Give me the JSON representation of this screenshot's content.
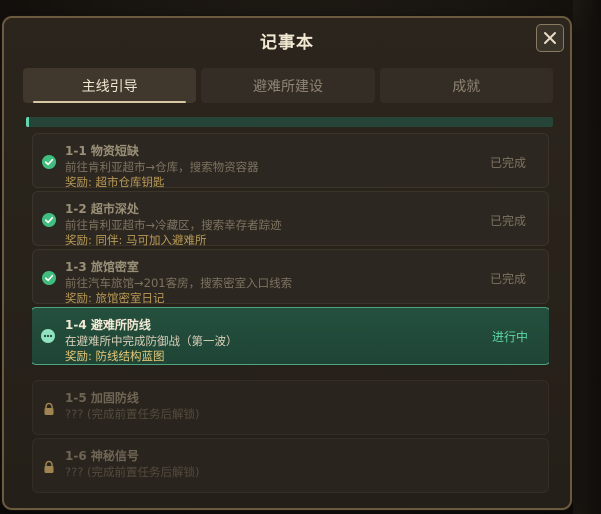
{
  "modal": {
    "title": "记事本",
    "close_icon": "close-icon"
  },
  "tabs": [
    {
      "label": "主线引导",
      "active": true
    },
    {
      "label": "避难所建设",
      "active": false
    },
    {
      "label": "成就",
      "active": false
    }
  ],
  "progress": {
    "fraction": 0.006
  },
  "quests": [
    {
      "title": "1-1 物资短缺",
      "desc": "前往肯利亚超市→仓库，搜索物资容器",
      "reward": "奖励: 超市仓库钥匙",
      "status": "已完成",
      "state": "done",
      "icon": "check-icon"
    },
    {
      "title": "1-2 超市深处",
      "desc": "前往肯利亚超市→冷藏区，搜索幸存者踪迹",
      "reward": "奖励: 同伴: 马可加入避难所",
      "status": "已完成",
      "state": "done",
      "icon": "check-icon"
    },
    {
      "title": "1-3 旅馆密室",
      "desc": "前往汽车旅馆→201客房，搜索密室入口线索",
      "reward": "奖励: 旅馆密室日记",
      "status": "已完成",
      "state": "done",
      "icon": "check-icon"
    },
    {
      "title": "1-4 避难所防线",
      "desc": "在避难所中完成防御战（第一波）",
      "reward": "奖励: 防线结构蓝图",
      "status": "进行中",
      "state": "active",
      "icon": "in-progress-icon"
    },
    {
      "title": "1-5 加固防线",
      "desc": "??? (完成前置任务后解锁)",
      "reward": "",
      "status": "",
      "state": "locked",
      "icon": "lock-icon"
    },
    {
      "title": "1-6 神秘信号",
      "desc": "??? (完成前置任务后解锁)",
      "reward": "",
      "status": "",
      "state": "locked",
      "icon": "lock-icon"
    }
  ],
  "colors": {
    "accent_green": "#5fd6a4",
    "reward_gold": "#b99a55",
    "panel_border": "#6b5a3e"
  }
}
